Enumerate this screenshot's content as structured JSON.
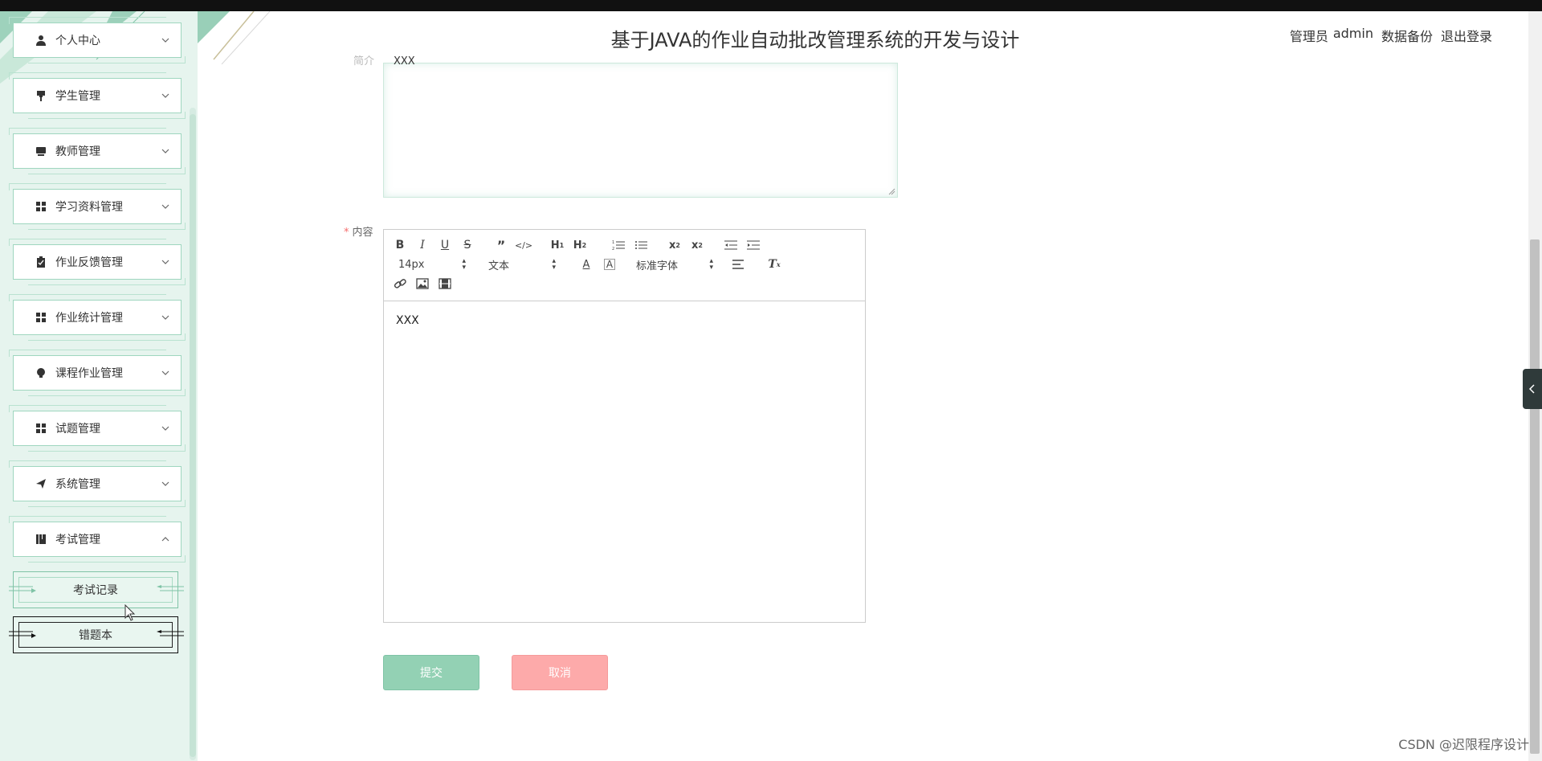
{
  "app": {
    "title": "基于JAVA的作业自动批改管理系统的开发与设计",
    "user_role": "管理员",
    "username": "admin",
    "backup_label": "数据备份",
    "logout_label": "退出登录"
  },
  "sidebar": {
    "items": [
      {
        "label": "个人中心",
        "icon": "user-icon",
        "expanded": false
      },
      {
        "label": "学生管理",
        "icon": "pin-icon",
        "expanded": false
      },
      {
        "label": "教师管理",
        "icon": "monitor-icon",
        "expanded": false
      },
      {
        "label": "学习资料管理",
        "icon": "grid-icon",
        "expanded": false
      },
      {
        "label": "作业反馈管理",
        "icon": "clipboard-icon",
        "expanded": false
      },
      {
        "label": "作业统计管理",
        "icon": "grid-icon",
        "expanded": false
      },
      {
        "label": "课程作业管理",
        "icon": "bulb-icon",
        "expanded": false
      },
      {
        "label": "试题管理",
        "icon": "grid-icon",
        "expanded": false
      },
      {
        "label": "系统管理",
        "icon": "send-icon",
        "expanded": false
      },
      {
        "label": "考试管理",
        "icon": "book-icon",
        "expanded": true
      }
    ],
    "subitems": [
      {
        "label": "考试记录"
      },
      {
        "label": "错题本"
      }
    ]
  },
  "form": {
    "intro_label": "简介",
    "intro_value": "XXX",
    "content_label": "内容",
    "content_value": "XXX",
    "toolbar": {
      "font_size": "14px",
      "header_select": "文本",
      "font_family": "标准字体"
    },
    "submit_label": "提交",
    "cancel_label": "取消"
  },
  "watermark": "CSDN @迟限程序设计",
  "colors": {
    "sidebar_bg": "#e6f4ee",
    "accent": "#93d1b4",
    "cancel": "#fdaaaa"
  }
}
